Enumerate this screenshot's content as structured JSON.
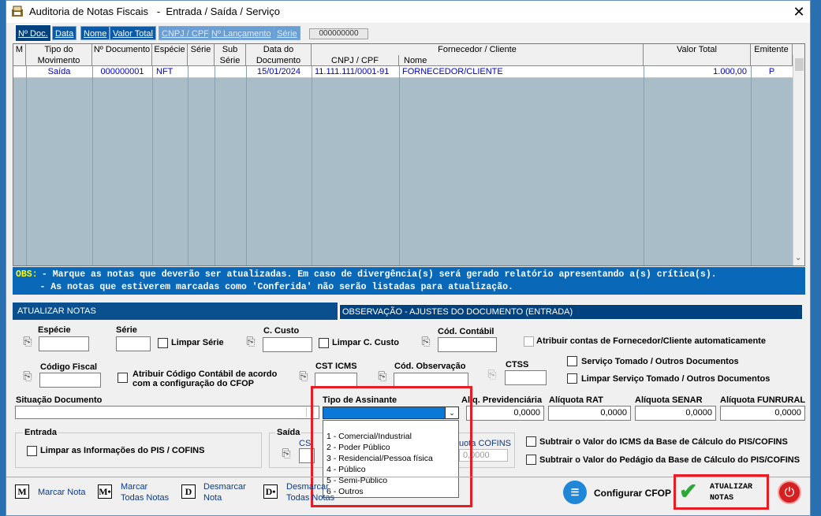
{
  "window": {
    "title": "Auditoria de Notas Fiscais   -  Entrada / Saída / Serviço",
    "close": "✕"
  },
  "tabs": [
    {
      "label": "Nº Doc."
    },
    {
      "label": "Data"
    },
    {
      "label": "Nome"
    },
    {
      "label": "Valor Total"
    },
    {
      "label": "CNPJ / CPF"
    },
    {
      "label": "Nº Lançamento"
    },
    {
      "label": "Série"
    }
  ],
  "search": {
    "value": "000000000"
  },
  "grid": {
    "headers": {
      "m": "M",
      "tipo1": "Tipo do",
      "tipo2": "Movimento",
      "ndoc": "Nº Documento",
      "especie": "Espécie",
      "serie": "Série",
      "sub1": "Sub",
      "sub2": "Série",
      "data1": "Data do",
      "data2": "Documento",
      "fornecedor": "Fornecedor / Cliente",
      "cnpj": "CNPJ / CPF",
      "nome": "Nome",
      "valor": "Valor Total",
      "emitente": "Emitente"
    },
    "rows": [
      {
        "tipo": "Saída",
        "ndoc": "000000001",
        "especie": "NFT",
        "data": "15/01/2024",
        "cnpj": "11.111.111/0001-91",
        "nome": "FORNECEDOR/CLIENTE",
        "valor": "1.000,00",
        "emitente": "P"
      }
    ]
  },
  "obs": {
    "label": "OBS:",
    "line1": " - Marque as notas que deverão ser atualizadas. Em caso de divergência(s) será gerado relatório apresentando a(s) crítica(s).",
    "line2": "     - As notas que estiverem marcadas como 'Conferida' não serão listadas para atualização."
  },
  "sections": {
    "atualizar": "ATUALIZAR NOTAS",
    "observacao": "OBSERVAÇÃO - AJUSTES DO DOCUMENTO (ENTRADA)"
  },
  "form": {
    "especie": "Espécie",
    "serie": "Série",
    "limpar_serie": "Limpar Série",
    "custo": "C. Custo",
    "limpar_custo": "Limpar C. Custo",
    "cod_contabil": "Cód. Contábil",
    "atribuir_contas": "Atribuir contas de Fornecedor/Cliente automaticamente",
    "codigo_fiscal": "Código Fiscal",
    "atribuir_codigo1": "Atribuir Código Contábil de acordo",
    "atribuir_codigo2": "com a configuração do CFOP",
    "cst_icms": "CST ICMS",
    "cod_obs": "Cód. Observação",
    "ctss": "CTSS",
    "servico_tomado": "Serviço Tomado / Outros Documentos",
    "limpar_servico": "Limpar Serviço Tomado / Outros Documentos",
    "situacao": "Situação Documento",
    "tipo_assinante": "Tipo de Assinante",
    "aliq_prev": "Alíq. Previdenciária",
    "aliq_prev_val": "0,0000",
    "aliq_rat": "Alíquota RAT",
    "aliq_rat_val": "0,0000",
    "aliq_senar": "Alíquota SENAR",
    "aliq_senar_val": "0,0000",
    "aliq_funrural": "Alíquota FUNRURAL",
    "aliq_funrural_val": "0,0000",
    "entrada": "Entrada",
    "limpar_pis": "Limpar as Informações do PIS / COFINS",
    "saida": "Saída",
    "cs_partial": "CS",
    "cofins_partial": "uota COFINS",
    "cofins_val": "0,0000",
    "subtrair_icms": "Subtrair o Valor do ICMS da Base de Cálculo  do PIS/COFINS",
    "subtrair_pedagio": "Subtrair o Valor do Pedágio da Base de Cálculo do PIS/COFINS"
  },
  "dropdown": {
    "options": [
      "1 - Comercial/Industrial",
      "2 - Poder Público",
      "3 - Residencial/Pessoa física",
      "4 - Público",
      "5 - Semi-Público",
      "6 - Outros"
    ]
  },
  "footer": {
    "marcar": "Marcar Nota",
    "marcar_todas1": "Marcar",
    "marcar_todas2": "Todas Notas",
    "desmarcar1": "Desmarcar",
    "desmarcar2": "Nota",
    "desmarcar_todas1": "Desmarcar",
    "desmarcar_todas2": "Todas Notas",
    "configurar": "Configurar CFOP",
    "atualizar": "ATUALIZAR\nNOTAS"
  }
}
